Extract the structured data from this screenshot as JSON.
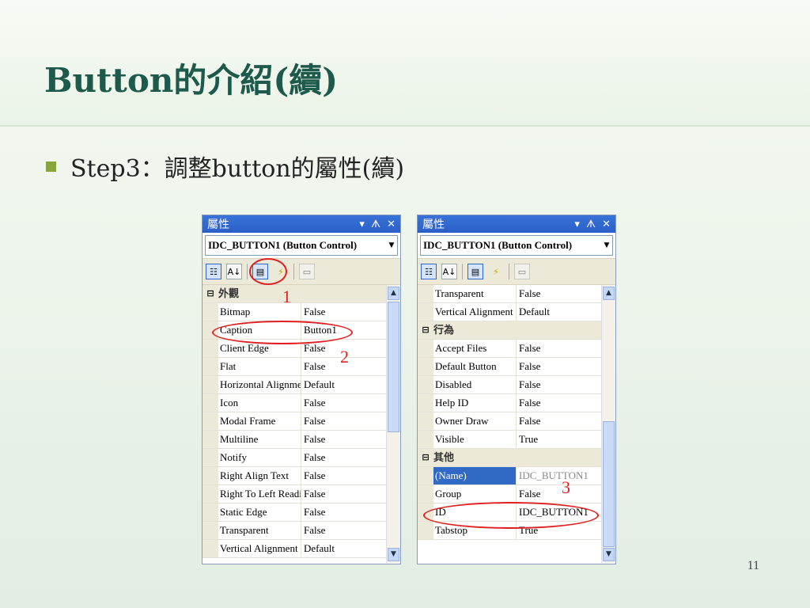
{
  "slide": {
    "title": "Button的介紹(續)",
    "bullet": "Step3：調整button的屬性(續)",
    "page_number": "11",
    "accent_color": "#1e5a4c",
    "bullet_color": "#8aa43c"
  },
  "panels": [
    {
      "title": "屬性",
      "title_buttons": [
        "▾",
        "ᗑ",
        "✕"
      ],
      "combo": "IDC_BUTTON1 (Button Control)",
      "toolbar_icons": [
        "categorized-icon",
        "alphabetical-icon",
        "properties-icon",
        "events-icon",
        "property-pages-icon"
      ],
      "rows": [
        {
          "type": "cat",
          "label": "外觀",
          "toggle": "⊟"
        },
        {
          "name": "Bitmap",
          "value": "False"
        },
        {
          "name": "Caption",
          "value": "Button1"
        },
        {
          "name": "Client Edge",
          "value": "False"
        },
        {
          "name": "Flat",
          "value": "False"
        },
        {
          "name": "Horizontal Alignment",
          "value": "Default"
        },
        {
          "name": "Icon",
          "value": "False"
        },
        {
          "name": "Modal Frame",
          "value": "False"
        },
        {
          "name": "Multiline",
          "value": "False"
        },
        {
          "name": "Notify",
          "value": "False"
        },
        {
          "name": "Right Align Text",
          "value": "False"
        },
        {
          "name": "Right To Left Reading",
          "value": "False"
        },
        {
          "name": "Static Edge",
          "value": "False"
        },
        {
          "name": "Transparent",
          "value": "False"
        },
        {
          "name": "Vertical Alignment",
          "value": "Default"
        }
      ]
    },
    {
      "title": "屬性",
      "title_buttons": [
        "▾",
        "ᗑ",
        "✕"
      ],
      "combo": "IDC_BUTTON1 (Button Control)",
      "toolbar_icons": [
        "categorized-icon",
        "alphabetical-icon",
        "properties-icon",
        "events-icon",
        "property-pages-icon"
      ],
      "rows": [
        {
          "name": "Transparent",
          "value": "False"
        },
        {
          "name": "Vertical Alignment",
          "value": "Default"
        },
        {
          "type": "cat",
          "label": "行為",
          "toggle": "⊟"
        },
        {
          "name": "Accept Files",
          "value": "False"
        },
        {
          "name": "Default Button",
          "value": "False"
        },
        {
          "name": "Disabled",
          "value": "False"
        },
        {
          "name": "Help ID",
          "value": "False"
        },
        {
          "name": "Owner Draw",
          "value": "False"
        },
        {
          "name": "Visible",
          "value": "True"
        },
        {
          "type": "cat",
          "label": "其他",
          "toggle": "⊟"
        },
        {
          "name": "(Name)",
          "value": "IDC_BUTTON1",
          "selected": true
        },
        {
          "name": "Group",
          "value": "False"
        },
        {
          "name": "ID",
          "value": "IDC_BUTTON1"
        },
        {
          "name": "Tabstop",
          "value": "True"
        }
      ]
    }
  ],
  "annotations": {
    "numbers": [
      "1",
      "2",
      "3"
    ],
    "color": "#e02020"
  }
}
